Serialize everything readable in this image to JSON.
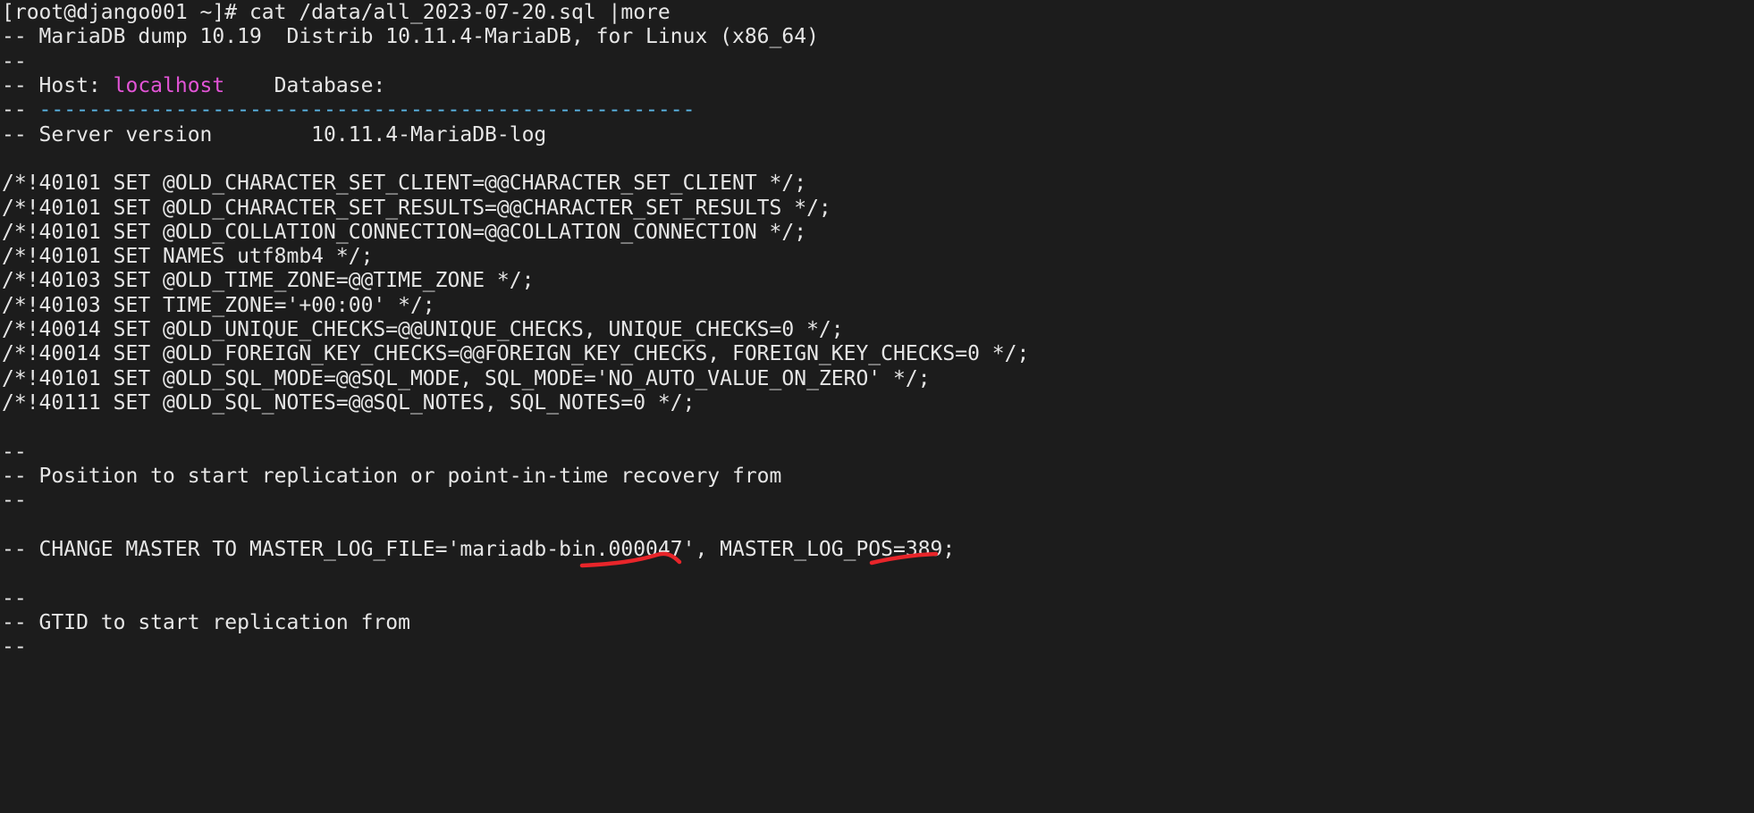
{
  "terminal": {
    "background_color": "#1c1c1c",
    "foreground_color": "#e6e6e6",
    "accent_magenta": "#e254d6",
    "accent_cyan": "#5bb7e8",
    "annotation_color": "#e8252a",
    "prompt": "[root@django001 ~]#",
    "command": "cat /data/all_2023-07-20.sql |more",
    "pager": "more",
    "lines": [
      {
        "id": "prompt-line",
        "parts": [
          {
            "text": "[root@django001 ~]# cat /data/all_2023-07-20.sql |more",
            "color": "default"
          }
        ]
      },
      {
        "id": "dump-header",
        "parts": [
          {
            "text": "-- MariaDB dump 10.19  Distrib 10.11.4-MariaDB, for Linux (x86_64)",
            "color": "default"
          }
        ]
      },
      {
        "id": "comment-blank-1",
        "parts": [
          {
            "text": "--",
            "color": "default"
          }
        ]
      },
      {
        "id": "host-line",
        "parts": [
          {
            "text": "-- Host: ",
            "color": "default"
          },
          {
            "text": "localhost",
            "color": "magenta"
          },
          {
            "text": "    Database: ",
            "color": "default"
          }
        ]
      },
      {
        "id": "separator-line",
        "parts": [
          {
            "text": "-- ",
            "color": "default"
          },
          {
            "text": "-----------------------------------------------------",
            "color": "cyan"
          }
        ]
      },
      {
        "id": "server-version-line",
        "parts": [
          {
            "text": "-- Server version\t10.11.4-MariaDB-log",
            "color": "default"
          }
        ]
      },
      {
        "id": "blank-1",
        "parts": [
          {
            "text": "",
            "color": "default"
          }
        ]
      },
      {
        "id": "set-old-charset-client",
        "parts": [
          {
            "text": "/*!40101 SET @OLD_CHARACTER_SET_CLIENT=@@CHARACTER_SET_CLIENT */;",
            "color": "default"
          }
        ]
      },
      {
        "id": "set-old-charset-results",
        "parts": [
          {
            "text": "/*!40101 SET @OLD_CHARACTER_SET_RESULTS=@@CHARACTER_SET_RESULTS */;",
            "color": "default"
          }
        ]
      },
      {
        "id": "set-old-collation-connection",
        "parts": [
          {
            "text": "/*!40101 SET @OLD_COLLATION_CONNECTION=@@COLLATION_CONNECTION */;",
            "color": "default"
          }
        ]
      },
      {
        "id": "set-names",
        "parts": [
          {
            "text": "/*!40101 SET NAMES utf8mb4 */;",
            "color": "default"
          }
        ]
      },
      {
        "id": "set-old-time-zone",
        "parts": [
          {
            "text": "/*!40103 SET @OLD_TIME_ZONE=@@TIME_ZONE */;",
            "color": "default"
          }
        ]
      },
      {
        "id": "set-time-zone",
        "parts": [
          {
            "text": "/*!40103 SET TIME_ZONE='+00:00' */;",
            "color": "default"
          }
        ]
      },
      {
        "id": "set-unique-checks",
        "parts": [
          {
            "text": "/*!40014 SET @OLD_UNIQUE_CHECKS=@@UNIQUE_CHECKS, UNIQUE_CHECKS=0 */;",
            "color": "default"
          }
        ]
      },
      {
        "id": "set-foreign-key-checks",
        "parts": [
          {
            "text": "/*!40014 SET @OLD_FOREIGN_KEY_CHECKS=@@FOREIGN_KEY_CHECKS, FOREIGN_KEY_CHECKS=0 */;",
            "color": "default"
          }
        ]
      },
      {
        "id": "set-sql-mode",
        "parts": [
          {
            "text": "/*!40101 SET @OLD_SQL_MODE=@@SQL_MODE, SQL_MODE='NO_AUTO_VALUE_ON_ZERO' */;",
            "color": "default"
          }
        ]
      },
      {
        "id": "set-sql-notes",
        "parts": [
          {
            "text": "/*!40111 SET @OLD_SQL_NOTES=@@SQL_NOTES, SQL_NOTES=0 */;",
            "color": "default"
          }
        ]
      },
      {
        "id": "blank-2",
        "parts": [
          {
            "text": "",
            "color": "default"
          }
        ]
      },
      {
        "id": "comment-blank-2",
        "parts": [
          {
            "text": "--",
            "color": "default"
          }
        ]
      },
      {
        "id": "position-comment",
        "parts": [
          {
            "text": "-- Position to start replication or point-in-time recovery from",
            "color": "default"
          }
        ]
      },
      {
        "id": "comment-blank-3",
        "parts": [
          {
            "text": "--",
            "color": "default"
          }
        ]
      },
      {
        "id": "blank-3",
        "parts": [
          {
            "text": "",
            "color": "default"
          }
        ]
      },
      {
        "id": "change-master-line",
        "parts": [
          {
            "text": "-- CHANGE MASTER TO MASTER_LOG_FILE='mariadb-bin.000047', MASTER_LOG_POS=389;",
            "color": "default"
          }
        ]
      },
      {
        "id": "blank-4",
        "parts": [
          {
            "text": "",
            "color": "default"
          }
        ]
      },
      {
        "id": "comment-blank-4",
        "parts": [
          {
            "text": "--",
            "color": "default"
          }
        ]
      },
      {
        "id": "gtid-comment",
        "parts": [
          {
            "text": "-- GTID to start replication from",
            "color": "default"
          }
        ]
      },
      {
        "id": "comment-blank-5",
        "parts": [
          {
            "text": "--",
            "color": "default"
          }
        ]
      }
    ],
    "annotations": [
      {
        "id": "underline-binlog-file",
        "label": "mariadb-bin.000047",
        "color": "#e8252a"
      },
      {
        "id": "underline-log-pos",
        "label": "MASTER_LOG_POS=389",
        "color": "#e8252a"
      }
    ]
  }
}
